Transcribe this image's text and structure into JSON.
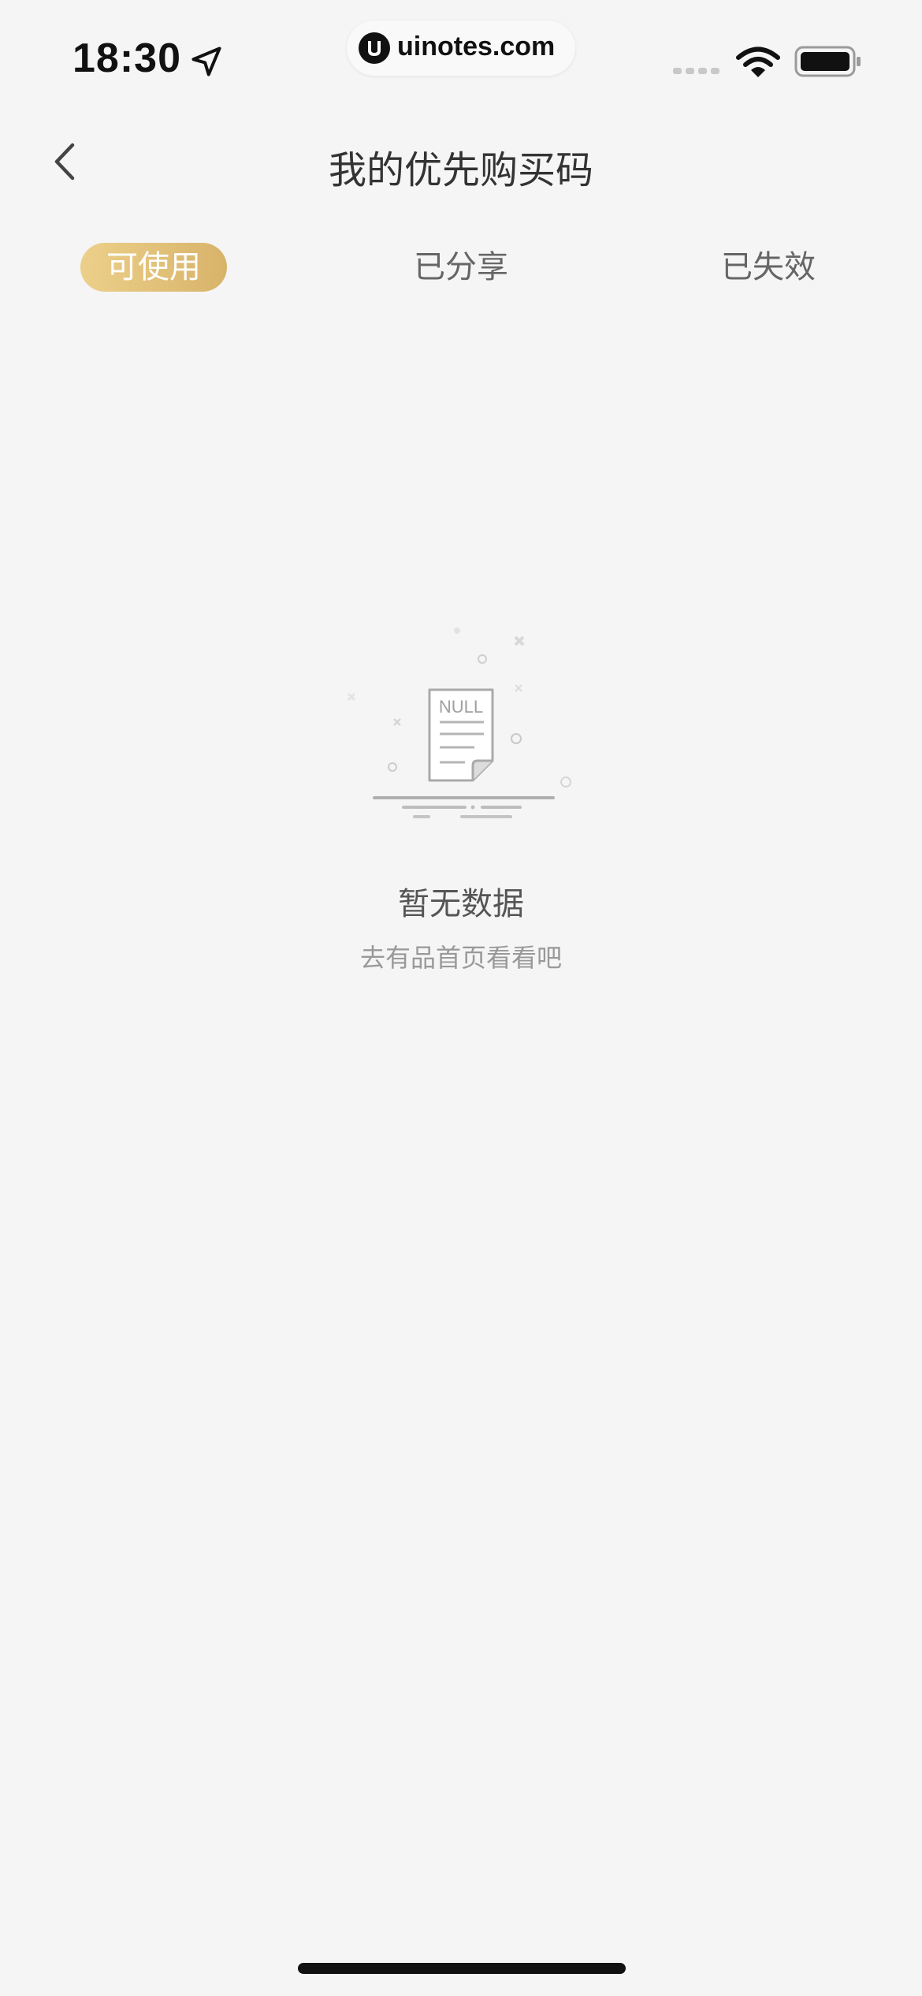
{
  "status_bar": {
    "time": "18:30",
    "watermark_text": "uinotes.com",
    "icons": [
      "location-arrow-icon",
      "signal-icon",
      "wifi-icon",
      "battery-icon"
    ]
  },
  "nav": {
    "title": "我的优先购买码",
    "back_icon": "chevron-left-icon"
  },
  "tabs": [
    {
      "label": "可使用",
      "active": true
    },
    {
      "label": "已分享",
      "active": false
    },
    {
      "label": "已失效",
      "active": false
    }
  ],
  "empty_state": {
    "illustration_label": "NULL",
    "title": "暂无数据",
    "subtitle": "去有品首页看看吧"
  },
  "colors": {
    "background": "#f5f5f5",
    "tab_active_start": "#ecd08a",
    "tab_active_end": "#d8b36a",
    "title_text": "#333333",
    "secondary_text": "#999999"
  }
}
